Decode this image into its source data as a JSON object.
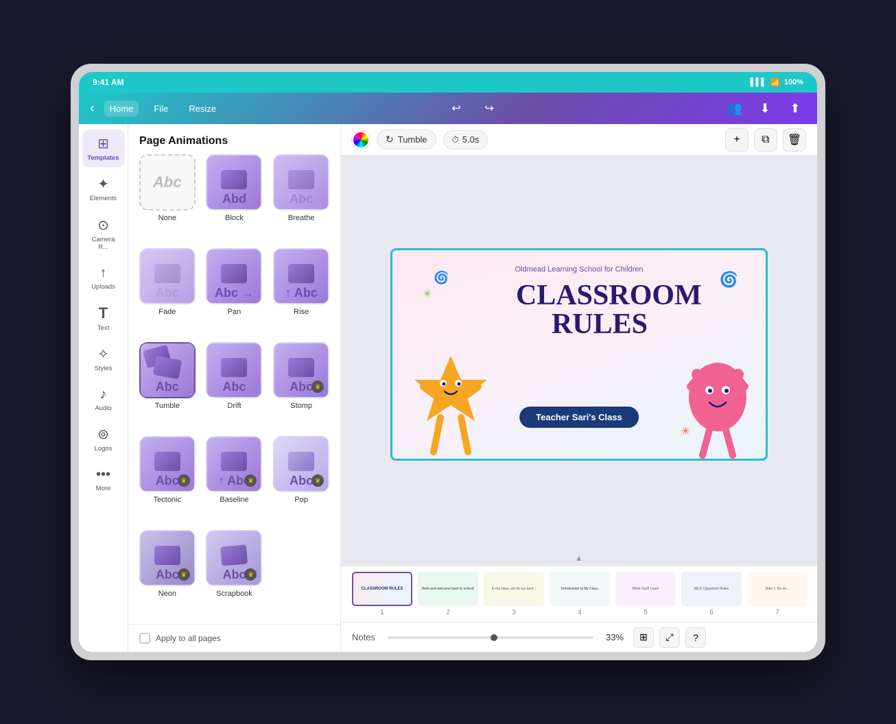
{
  "device": {
    "status_bar": {
      "time": "9:41 AM",
      "signal": "▌▌▌",
      "wifi": "wifi",
      "battery": "100%"
    }
  },
  "toolbar": {
    "back_label": "‹",
    "home_label": "Home",
    "file_label": "File",
    "resize_label": "Resize",
    "undo_label": "↩",
    "redo_label": "↪"
  },
  "sidebar": {
    "items": [
      {
        "icon": "⊞",
        "label": "Templates"
      },
      {
        "icon": "✦",
        "label": "Elements"
      },
      {
        "icon": "⊙",
        "label": "Camera R..."
      },
      {
        "icon": "↑",
        "label": "Uploads"
      },
      {
        "icon": "T",
        "label": "Text"
      },
      {
        "icon": "✧",
        "label": "Styles"
      },
      {
        "icon": "♪",
        "label": "Audio"
      },
      {
        "icon": "⊚",
        "label": "Logos"
      },
      {
        "icon": "•••",
        "label": "More"
      }
    ]
  },
  "panel": {
    "title": "Page Animations",
    "animations": [
      {
        "id": "none",
        "label": "None",
        "type": "dashed"
      },
      {
        "id": "block",
        "label": "Block",
        "type": "normal"
      },
      {
        "id": "breathe",
        "label": "Breathe",
        "type": "normal"
      },
      {
        "id": "fade",
        "label": "Fade",
        "type": "normal"
      },
      {
        "id": "pan",
        "label": "Pan",
        "type": "normal"
      },
      {
        "id": "rise",
        "label": "Rise",
        "type": "normal"
      },
      {
        "id": "tumble",
        "label": "Tumble",
        "type": "selected"
      },
      {
        "id": "drift",
        "label": "Drift",
        "type": "normal"
      },
      {
        "id": "stomp",
        "label": "Stomp",
        "type": "premium"
      },
      {
        "id": "tectonic",
        "label": "Tectonic",
        "type": "premium"
      },
      {
        "id": "baseline",
        "label": "Baseline",
        "type": "premium"
      },
      {
        "id": "pop",
        "label": "Pop",
        "type": "premium"
      },
      {
        "id": "neon",
        "label": "Neon",
        "type": "premium"
      },
      {
        "id": "scrapbook",
        "label": "Scrapbook",
        "type": "premium"
      }
    ],
    "apply_all": "Apply to all pages"
  },
  "canvas": {
    "animation_label": "Tumble",
    "duration": "5.0s",
    "slide": {
      "school_name": "Oldmead Learning School for Children",
      "title_line1": "CLASSROOM",
      "title_line2": "RULES",
      "subtitle": "Teacher Sari's Class"
    }
  },
  "filmstrip": {
    "pages": [
      {
        "num": "1",
        "active": true
      },
      {
        "num": "2",
        "active": false
      },
      {
        "num": "3",
        "active": false
      },
      {
        "num": "4",
        "active": false
      },
      {
        "num": "5",
        "active": false
      },
      {
        "num": "6",
        "active": false
      },
      {
        "num": "7",
        "active": false
      }
    ]
  },
  "bottom_bar": {
    "notes_label": "Notes",
    "zoom": "33%"
  }
}
